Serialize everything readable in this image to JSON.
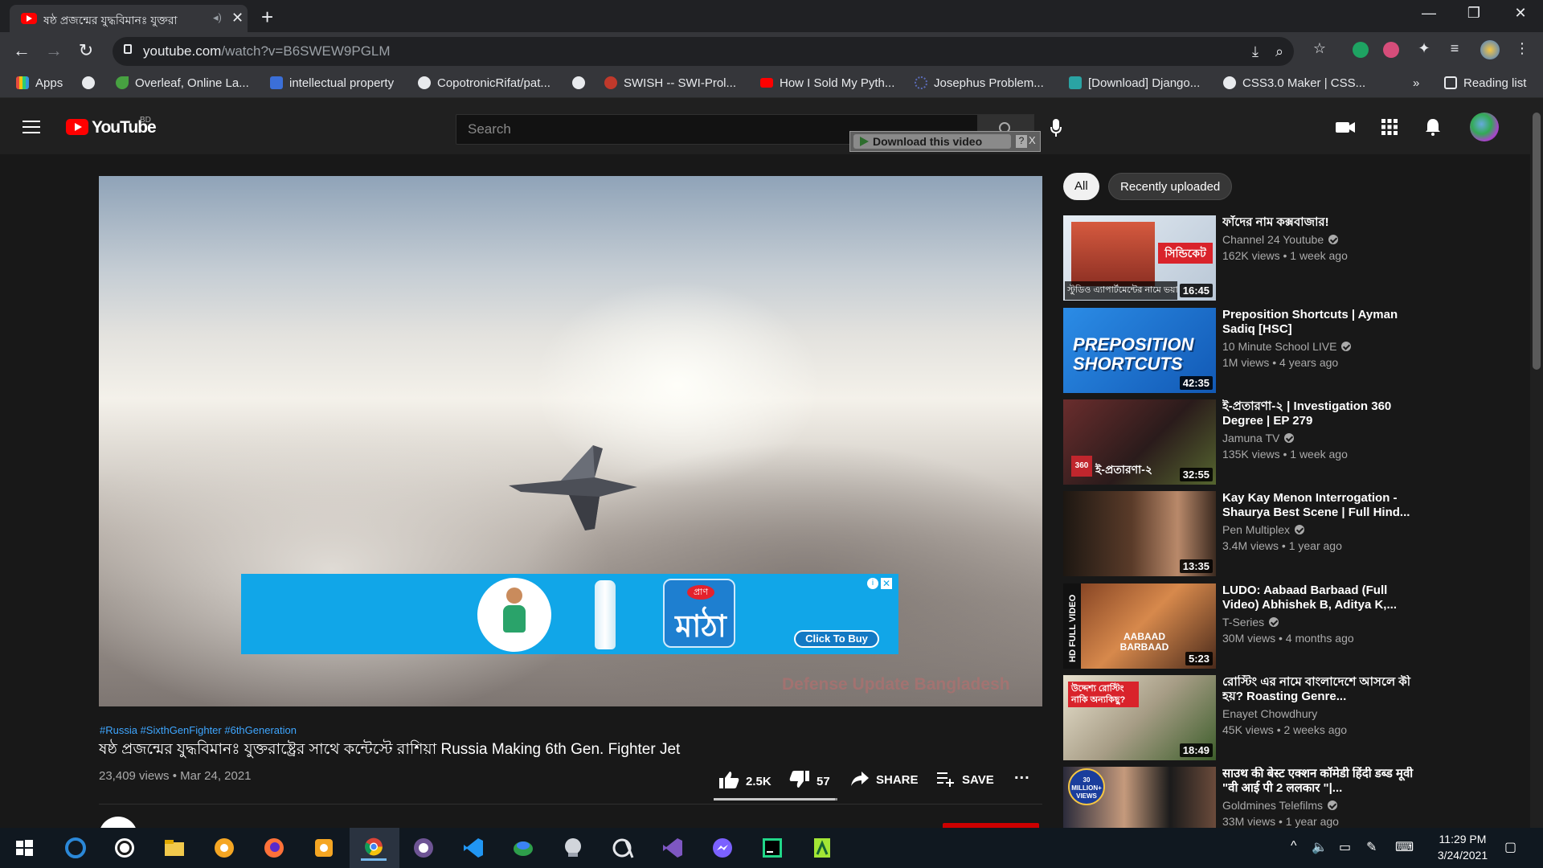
{
  "browser": {
    "tab_title": "ষষ্ঠ প্রজন্মের যুদ্ধবিমানঃ যুক্তরা",
    "url_host": "youtube.com",
    "url_path": "/watch?v=B6SWEW9PGLM",
    "bookmarks": [
      {
        "label": "Apps",
        "color": "#e74c3c"
      },
      {
        "label": "",
        "color": "#e8eaed"
      },
      {
        "label": "Overleaf, Online La...",
        "color": "#47a141"
      },
      {
        "label": "intellectual property",
        "color": "#3b6fd8"
      },
      {
        "label": "CopotronicRifat/pat...",
        "color": "#e8eaed"
      },
      {
        "label": "",
        "color": "#e8eaed"
      },
      {
        "label": "SWISH -- SWI-Prol...",
        "color": "#c0392b"
      },
      {
        "label": "How I Sold My Pyth...",
        "color": "#ff0000"
      },
      {
        "label": "Josephus Problem...",
        "color": "#5b6cb8"
      },
      {
        "label": "[Download] Django...",
        "color": "#2aa3a3"
      },
      {
        "label": "CSS3.0 Maker | CSS...",
        "color": "#e8eaed"
      }
    ],
    "overflow_label": "»",
    "reading_list": "Reading list"
  },
  "youtube": {
    "logo_text": "YouTube",
    "country_code": "BD",
    "search_placeholder": "Search",
    "download_label": "Download this video",
    "download_help": "?",
    "download_close": "X"
  },
  "video": {
    "watermark": "Defense Update Bangladesh",
    "ad": {
      "brand_tag": "প্রাণ",
      "brand_name": "মাঠা",
      "cta": "Click To Buy",
      "info": "i",
      "close": "✕"
    },
    "hashtags": "#Russia #SixthGenFighter #6thGeneration",
    "title": "ষষ্ঠ প্রজন্মের যুদ্ধবিমানঃ যুক্তরাষ্ট্রের সাথে কন্টেস্টে রাশিয়া Russia Making 6th Gen. Fighter Jet",
    "meta": "23,409 views • Mar 24, 2021",
    "likes": "2.5K",
    "dislikes": "57",
    "like_ratio": 0.978,
    "share": "SHARE",
    "save": "SAVE",
    "more": "..."
  },
  "chips": [
    "All",
    "Recently uploaded"
  ],
  "recommendations": [
    {
      "title": "ফাঁদের নাম কক্সবাজার!",
      "channel": "Channel 24 Youtube",
      "verified": true,
      "views": "162K views • 1 week ago",
      "duration": "16:45",
      "thumb": "ch24"
    },
    {
      "title": "Preposition Shortcuts | Ayman Sadiq [HSC]",
      "channel": "10 Minute School LIVE",
      "verified": true,
      "views": "1M views • 4 years ago",
      "duration": "42:35",
      "thumb": "prep"
    },
    {
      "title": "ই-প্রতারণা-২ | Investigation 360 Degree | EP 279",
      "channel": "Jamuna TV",
      "verified": true,
      "views": "135K views • 1 week ago",
      "duration": "32:55",
      "thumb": "i360"
    },
    {
      "title": "Kay Kay Menon Interrogation - Shaurya Best Scene | Full Hind...",
      "channel": "Pen Multiplex",
      "verified": true,
      "views": "3.4M views • 1 year ago",
      "duration": "13:35",
      "thumb": "kk"
    },
    {
      "title": "LUDO: Aabaad Barbaad (Full Video) Abhishek B, Aditya K,...",
      "channel": "T-Series",
      "verified": true,
      "views": "30M views • 4 months ago",
      "duration": "5:23",
      "thumb": "ludo"
    },
    {
      "title": "রোস্টিং এর নামে বাংলাদেশে আসলে কী হয়? Roasting Genre...",
      "channel": "Enayet Chowdhury",
      "verified": false,
      "views": "45K views • 2 weeks ago",
      "duration": "18:49",
      "thumb": "roast"
    },
    {
      "title": "साउथ की बेस्ट एक्शन कॉमेडी हिंदी डब्ड मूवी \"वी आई पी 2 ललकार \"|...",
      "channel": "Goldmines Telefilms",
      "verified": true,
      "views": "33M views • 1 year ago",
      "duration": "",
      "thumb": "gold"
    }
  ],
  "thumb_text": {
    "ch24": "স্টুডিও এ্যাপার্টমেন্টের নামে ভয়াব",
    "ch24_badge": "সিন্ডিকেট",
    "prep": "PREPOSITION SHORTCUTS",
    "i360": "ই-প্রতারণা-২",
    "i360_logo": "360",
    "ludo_side": "HD FULL VIDEO",
    "ludo": "AABAAD BARBAAD",
    "roast": "উদ্দেশ্য রোস্টিং নাকি অন্যকিছু?",
    "gold_badge": "30 MILLION+ VIEWS"
  },
  "taskbar": {
    "time": "11:29 PM",
    "date": "3/24/2021"
  }
}
